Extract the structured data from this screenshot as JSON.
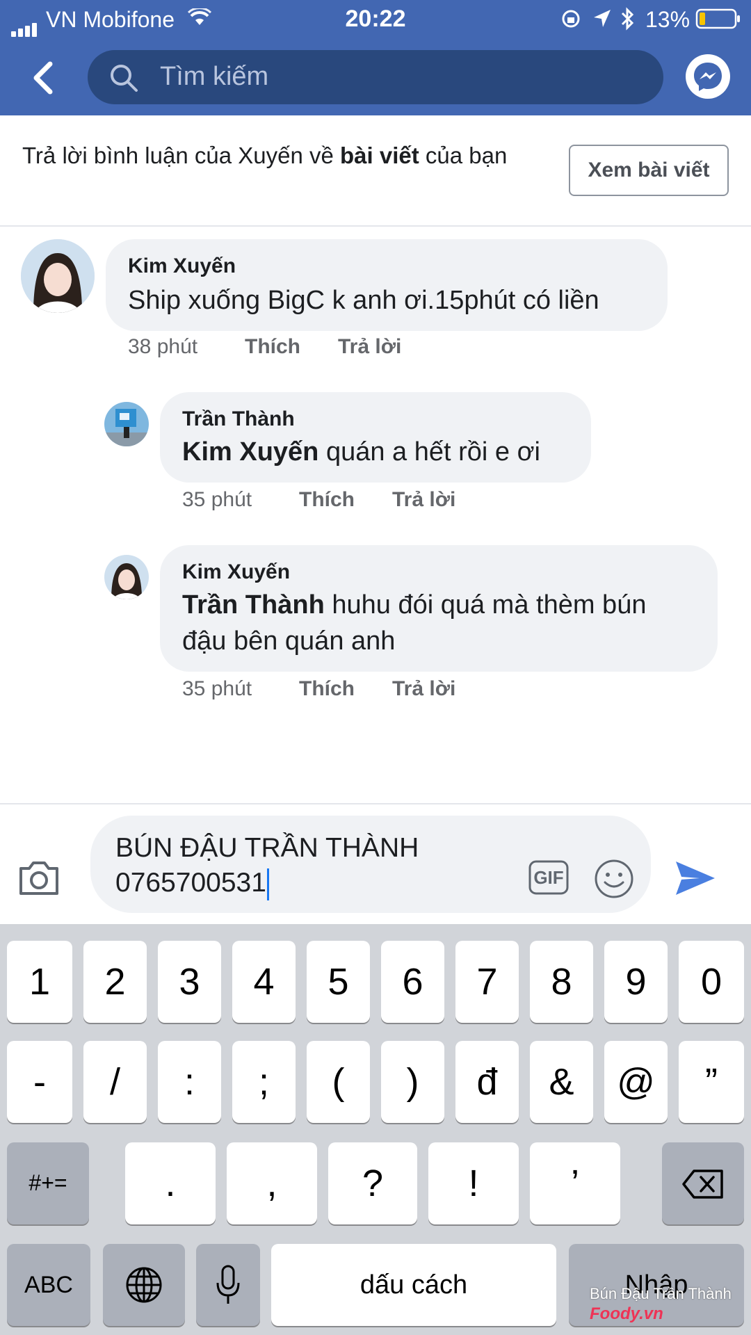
{
  "status_bar": {
    "carrier": "VN Mobifone",
    "time": "20:22",
    "battery": "13%"
  },
  "header": {
    "search_placeholder": "Tìm kiếm",
    "brand_color": "#4267b2"
  },
  "banner": {
    "text_before": "Trả lời bình luận của Xuyến về ",
    "text_bold": "bài viết",
    "text_after": " của bạn",
    "button_label": "Xem bài viết"
  },
  "comments": [
    {
      "author": "Kim Xuyến",
      "mention": "",
      "text": "Ship xuống BigC k anh ơi.15phút có liền",
      "time": "38 phút",
      "like": "Thích",
      "reply": "Trả lời"
    },
    {
      "author": "Trần Thành",
      "mention": "Kim Xuyến",
      "text": " quán a hết rồi e ơi",
      "time": "35 phút",
      "like": "Thích",
      "reply": "Trả lời"
    },
    {
      "author": "Kim Xuyến",
      "mention": "Trần Thành",
      "text": " huhu đói quá mà thèm bún",
      "text_line2": "đậu bên quán anh",
      "time": "35 phút",
      "like": "Thích",
      "reply": "Trả lời"
    }
  ],
  "composer": {
    "line1": "BÚN ĐẬU TRẦN THÀNH",
    "line2": "0765700531",
    "gif_label": "GIF"
  },
  "keyboard": {
    "row1": [
      "1",
      "2",
      "3",
      "4",
      "5",
      "6",
      "7",
      "8",
      "9",
      "0"
    ],
    "row2": [
      "-",
      "/",
      ":",
      ";",
      "(",
      ")",
      "đ",
      "&",
      "@",
      "”"
    ],
    "row3": [
      ".",
      ",",
      "?",
      "!",
      "’"
    ],
    "symbols_key": "#+=",
    "abc_key": "ABC",
    "space_key": "dấu cách",
    "return_key": "Nhập"
  },
  "watermark": {
    "text": "Bún Đậu Trần Thành",
    "brand": "Foody.vn"
  }
}
